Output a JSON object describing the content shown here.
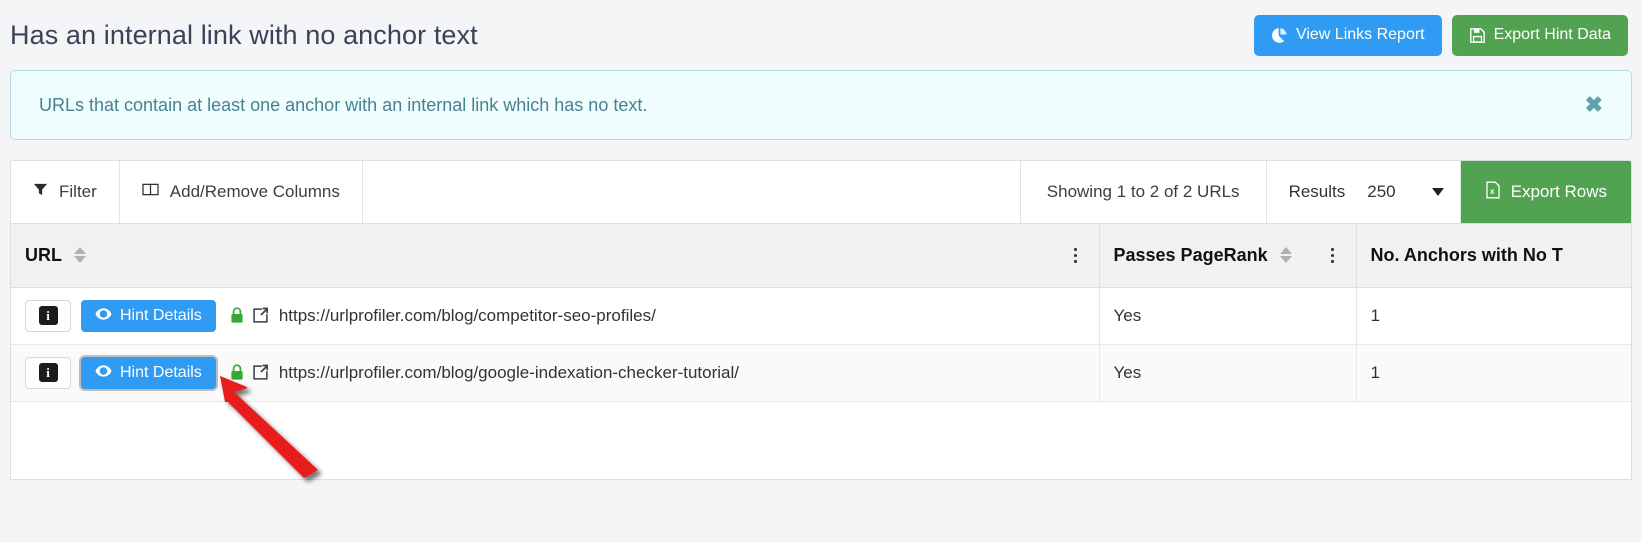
{
  "header": {
    "title": "Has an internal link with no anchor text",
    "view_links_label": "View Links Report",
    "export_hint_label": "Export Hint Data",
    "blue_accent": "#2f9bf2",
    "green_accent": "#51a351"
  },
  "banner": {
    "text": "URLs that contain at least one anchor with an internal link which has no text.",
    "close_label": "✖",
    "background": "#f0fdfe",
    "border": "#b4dbe4",
    "text_color": "#48818f"
  },
  "toolbar": {
    "filter_label": "Filter",
    "columns_label": "Add/Remove Columns",
    "showing_label": "Showing 1 to 2 of 2 URLs",
    "results_label": "Results",
    "results_value": "250",
    "results_options": [
      "250"
    ],
    "export_rows_label": "Export Rows"
  },
  "table": {
    "columns": [
      {
        "label": "URL",
        "sortable": true,
        "has_menu": true
      },
      {
        "label": "Passes PageRank",
        "sortable": true,
        "has_menu": true
      },
      {
        "label": "No. Anchors with No T",
        "sortable": false,
        "has_menu": false
      }
    ],
    "rows": [
      {
        "info_glyph": "i",
        "hint_label": "Hint Details",
        "secure": true,
        "url": "https://urlprofiler.com/blog/competitor-seo-profiles/",
        "passes_pagerank": "Yes",
        "anchors_no_text": "1",
        "focused": false
      },
      {
        "info_glyph": "i",
        "hint_label": "Hint Details",
        "secure": true,
        "url": "https://urlprofiler.com/blog/google-indexation-checker-tutorial/",
        "passes_pagerank": "Yes",
        "anchors_no_text": "1",
        "focused": true
      }
    ]
  },
  "annotation": {
    "type": "arrow",
    "color": "#e81c1c",
    "points_at": "Hint Details button on row 2"
  }
}
